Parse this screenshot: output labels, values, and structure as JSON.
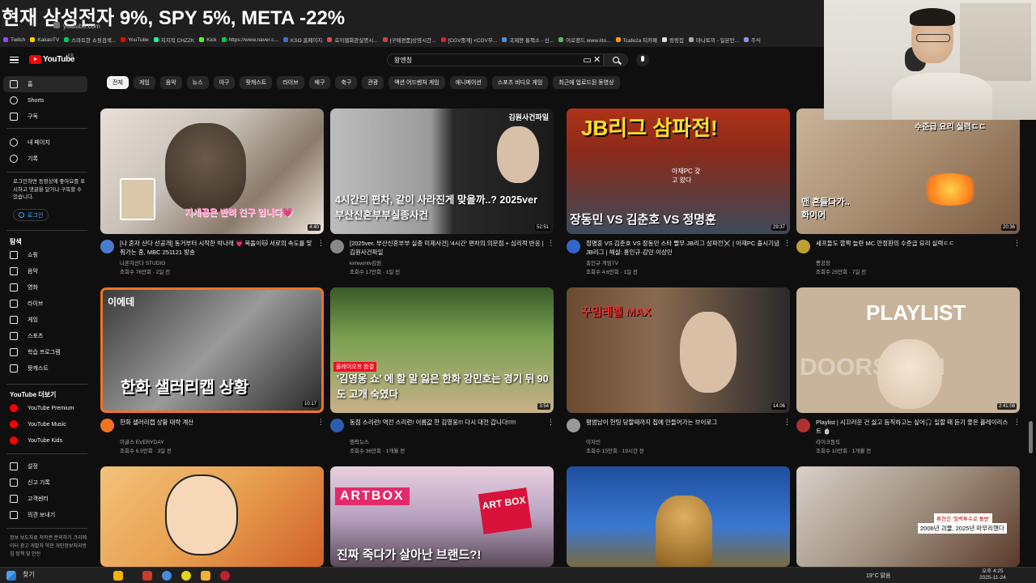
{
  "overlay": {
    "headline": "현재 삼성전자 9%, SPY 5%, META -22%"
  },
  "browser": {
    "url": "youtube.com",
    "bookmarks": [
      {
        "label": "Twitch",
        "color": "#9146ff"
      },
      {
        "label": "KakaoTV",
        "color": "#ffcd00"
      },
      {
        "label": "스마트한 쇼핑검색...",
        "color": "#03c75a"
      },
      {
        "label": "YouTube",
        "color": "#ff0000"
      },
      {
        "label": "치지직 CHZZK",
        "color": "#00ffa3"
      },
      {
        "label": "Kick",
        "color": "#53fc18"
      },
      {
        "label": "https://www.naver.c...",
        "color": "#03c75a"
      },
      {
        "label": "KSO 홈페이지",
        "color": "#3a6fd8"
      },
      {
        "label": "효이웹화관실명시...",
        "color": "#e04b4b"
      },
      {
        "label": "[구매경품]상영시간...",
        "color": "#c94040"
      },
      {
        "label": "[CGV중계] <CGV무...",
        "color": "#e51937"
      },
      {
        "label": "국제봉 통책소 - 신...",
        "color": "#4a90d9"
      },
      {
        "label": "이로랜드 www.iIto...",
        "color": "#5fb85f"
      },
      {
        "label": "Tcafe2a 티카페",
        "color": "#f39c12"
      },
      {
        "label": "링링집",
        "color": "#ddd"
      },
      {
        "label": "마나토끼 - 일본만...",
        "color": "#aaa"
      },
      {
        "label": "주식",
        "color": "#8e8ee0"
      }
    ]
  },
  "header": {
    "logo_text": "YouTube",
    "region": "KR",
    "search_value": "왕엔청"
  },
  "sidebar": {
    "main": [
      {
        "label": "홈",
        "icon": "home-icon"
      },
      {
        "label": "Shorts",
        "icon": "shorts-icon"
      },
      {
        "label": "구독",
        "icon": "subscriptions-icon"
      }
    ],
    "you": [
      {
        "label": "내 페이지",
        "icon": "account-icon"
      },
      {
        "label": "기록",
        "icon": "history-icon"
      }
    ],
    "login_message": "로그인하면 동영상에 좋아요를 표시하고 댓글을 달거나 구독할 수 있습니다.",
    "login_label": "로그인",
    "explore_title": "탐색",
    "explore": [
      {
        "label": "쇼핑",
        "icon": "shopping-icon"
      },
      {
        "label": "음악",
        "icon": "music-icon"
      },
      {
        "label": "영화",
        "icon": "movie-icon"
      },
      {
        "label": "라이브",
        "icon": "live-icon"
      },
      {
        "label": "게임",
        "icon": "gaming-icon"
      },
      {
        "label": "스포츠",
        "icon": "sports-icon"
      },
      {
        "label": "학습 프로그램",
        "icon": "learning-icon"
      },
      {
        "label": "팟캐스트",
        "icon": "podcast-icon"
      }
    ],
    "more_title": "YouTube 더보기",
    "more": [
      {
        "label": "YouTube Premium",
        "icon": "youtube-premium-icon"
      },
      {
        "label": "YouTube Music",
        "icon": "youtube-music-icon"
      },
      {
        "label": "YouTube Kids",
        "icon": "youtube-kids-icon"
      }
    ],
    "settings": [
      {
        "label": "설정",
        "icon": "settings-icon"
      },
      {
        "label": "신고 기록",
        "icon": "flag-icon"
      },
      {
        "label": "고객센터",
        "icon": "help-icon"
      },
      {
        "label": "의견 보내기",
        "icon": "feedback-icon"
      }
    ],
    "footer": "정보 보도자료 저작권 문의하기 크리에이터 광고 개발자 약관 개인정보처리방침 정책 및 안전"
  },
  "chips": [
    "전체",
    "게임",
    "음악",
    "뉴스",
    "야구",
    "팟캐스트",
    "라이브",
    "배구",
    "축구",
    "관광",
    "액션 어드벤처 게임",
    "애니메이션",
    "스포츠 비디오 게임",
    "최근에 업로드된 동영상"
  ],
  "videos": [
    {
      "title": "[나 혼자 산다 선공개] 동거부터 시작한 박나래 💗 복돌이🐱 서로의 속도를 맞춰가는 중, MBC 251121 방송",
      "channel": "나혼자산다 STUDIO",
      "meta": "조회수 76만회 · 2일 전",
      "duration": "4:40",
      "thumb_text": "지세공은 반려 친구 입니다💗",
      "avatar_color": "#4a7bd0"
    },
    {
      "title": "[2025ver. 부산신혼부부 실종 미제사건] '4시간' 편차의 의문점 + 심리적 반응 | 김원사건파일",
      "channel": "kimwontv김원",
      "meta": "조회수 17만회 · 1일 전",
      "duration": "52:51",
      "thumb_text": "4시간의 편차, 같이 사라진게 맞을까..? 2025ver 부산신혼부부실종사건",
      "avatar_color": "#888"
    },
    {
      "title": "정명훈 VS 김춘호 VS 장동민 스타 빨무 JB리그 삼파전⚔️ | 아재PC 출시기념 JB리그 | 해설: 홍인규·강민·이상민",
      "channel": "홍인규 게임TV",
      "meta": "조회수 4.6만회 · 1일 전",
      "duration": "29:37",
      "thumb_text": "JB리그 삼파전!",
      "avatar_color": "#3366cc"
    },
    {
      "title": "세프들도 깜짝 놀란 MC 안정환의 수준급 요리 실력ㄷㄷ",
      "channel": "뽕공장",
      "meta": "조회수 25만회 · 7일 전",
      "duration": "20:36",
      "thumb_text": "수준급 요리 실력ㄷㄷ",
      "avatar_color": "#c0a030"
    },
    {
      "title": "한화 샐러리캡 상황 대략 계산",
      "channel": "이글스 EVERYDAY",
      "meta": "조회수 6.5만회 · 3일 전",
      "duration": "10:17",
      "thumb_text": "한화 샐러리캡 상황",
      "avatar_color": "#f37321"
    },
    {
      "title": "동점 스리런! 역전 스리런! 이름값 한 김영웅!!! 다시 대전 갑니다!!!!!",
      "channel": "엠팍뉴스",
      "meta": "조회수 36만회 · 1개월 전",
      "duration": "3:54",
      "thumb_text": "'김영웅 쇼' 에 할 말 잃은 한화 강민호는 경기 뒤 90도 고개 숙였다",
      "avatar_color": "#2d5db0"
    },
    {
      "title": "평범남이 헌팅 당할때까지 집에 안들어가는 브이로그",
      "channel": "이자빈",
      "meta": "조회수 15만회 · 19시간 전",
      "duration": "14:06",
      "thumb_text": "꾸밈레벨 MAX",
      "avatar_color": "#9a9a9a"
    },
    {
      "title": "Playlist | 시끄러운 건 싫고 듬직하고는 싶어🎧 일할 때 듣기 좋은 플레이리스트 🍵",
      "channel": "라이크듬직",
      "meta": "조회수 10만회 · 1개월 전",
      "duration": "2:41:08",
      "thumb_text": "PLAYLIST",
      "avatar_color": "#b03030"
    },
    {
      "title": "",
      "channel": "",
      "meta": "",
      "duration": "",
      "thumb_text": "",
      "avatar_color": "#555"
    },
    {
      "title": "",
      "channel": "",
      "meta": "",
      "duration": "",
      "thumb_text": "진짜 죽다가 살아난 브랜드?!",
      "avatar_color": "#555"
    },
    {
      "title": "",
      "channel": "",
      "meta": "",
      "duration": "",
      "thumb_text": "",
      "avatar_color": "#555"
    },
    {
      "title": "",
      "channel": "",
      "meta": "",
      "duration": "",
      "thumb_text": "2006년 괴물, 2025년 마무리했다",
      "avatar_color": "#555"
    }
  ],
  "thumb_extras": {
    "v2_badge": "김원사건파일",
    "v3_sub": "아재PC 갖고 왔다",
    "v3_names": "장동민 VS 김춘호 VS 정명훈",
    "v4_sub": "맨 흔들다가.. 화이어",
    "v5_badge": "이에데",
    "v6_badge": "플레이오프 완결",
    "v8_sub": "DOORSCHTI",
    "v10_badge": "ARTBOX",
    "v10_badge2": "ART BOX",
    "v12_caption": "류현진 '철벽투수로 돌변'"
  },
  "taskbar": {
    "search_label": "찾기",
    "weather": "19°C 맑음",
    "time": "오후 4:25",
    "date": "2025-11-24"
  },
  "colors": {
    "youtube_red": "#ff0000",
    "link_blue": "#3ea6ff",
    "bg": "#0f0f0f"
  }
}
